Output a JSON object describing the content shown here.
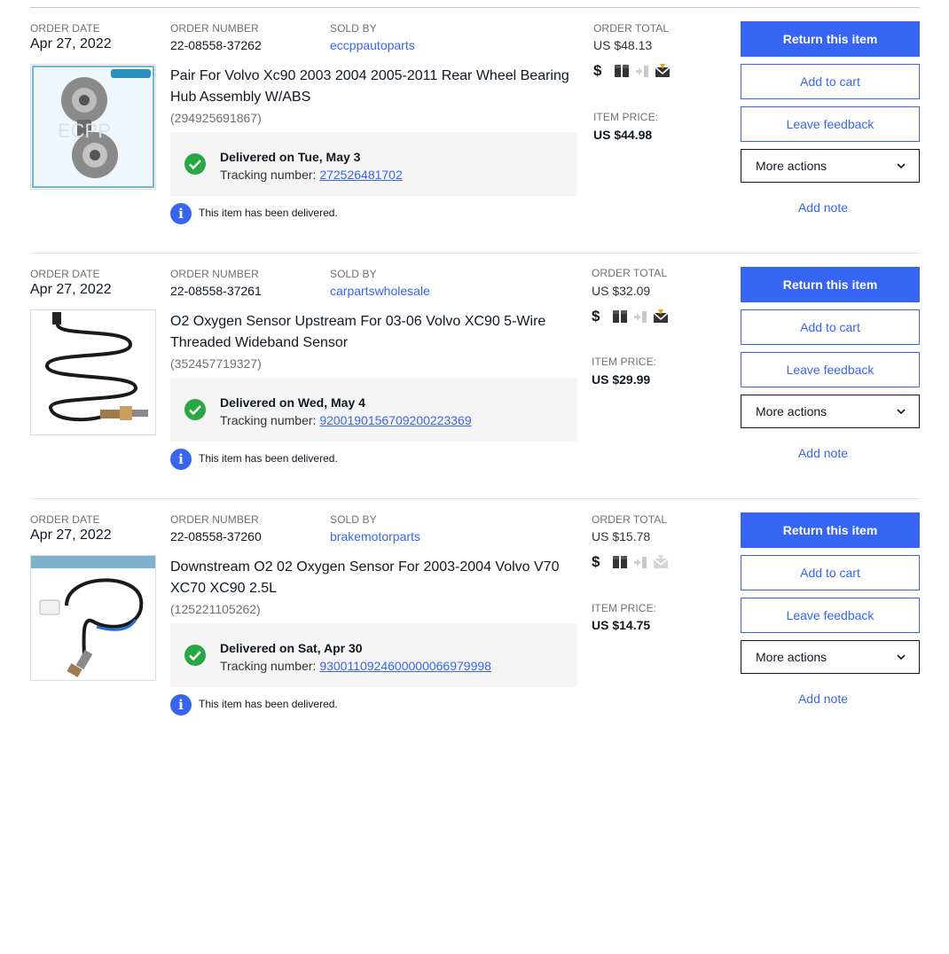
{
  "labels": {
    "order_date": "ORDER DATE",
    "order_number": "ORDER NUMBER",
    "sold_by": "SOLD BY",
    "order_total": "ORDER TOTAL",
    "item_price": "ITEM PRICE:",
    "tracking_prefix": "Tracking number: ",
    "delivered_info": "This item has been delivered."
  },
  "actions": {
    "return": "Return this item",
    "add_to_cart": "Add to cart",
    "leave_feedback": "Leave feedback",
    "more_actions": "More actions",
    "add_note": "Add note"
  },
  "colors": {
    "accent": "#3665f3",
    "success": "#28a745",
    "text": "#111820",
    "muted": "#707070"
  },
  "icons": [
    "dollar-icon",
    "package-icon",
    "shipped-icon",
    "message-icon"
  ],
  "orders": [
    {
      "date": "Apr 27, 2022",
      "number": "22-08558-37262",
      "seller": "eccppautoparts",
      "title": "Pair For Volvo Xc90 2003 2004 2005-2011 Rear Wheel Bearing Hub Assembly W/ABS",
      "item_id": "(294925691867)",
      "delivered": "Delivered on Tue, May 3",
      "tracking": "272526481702",
      "total": "US $48.13",
      "price": "US $44.98",
      "image": "wheel-hub-image",
      "message_active": true
    },
    {
      "date": "Apr 27, 2022",
      "number": "22-08558-37261",
      "seller": "carpartswholesale",
      "title": "O2 Oxygen Sensor Upstream For 03-06 Volvo XC90 5-Wire Threaded Wideband Sensor",
      "item_id": "(352457719327)",
      "delivered": "Delivered on Wed, May 4",
      "tracking": "9200190156709200223369",
      "total": "US $32.09",
      "price": "US $29.99",
      "image": "oxygen-sensor-image",
      "message_active": true
    },
    {
      "date": "Apr 27, 2022",
      "number": "22-08558-37260",
      "seller": "brakemotorparts",
      "title": "Downstream O2 02 Oxygen Sensor For 2003-2004 Volvo V70 XC70 XC90 2.5L",
      "item_id": "(125221105262)",
      "delivered": "Delivered on Sat, Apr 30",
      "tracking": "9300110924600000066979998",
      "total": "US $15.78",
      "price": "US $14.75",
      "image": "oxygen-sensor-image",
      "message_active": false
    }
  ]
}
